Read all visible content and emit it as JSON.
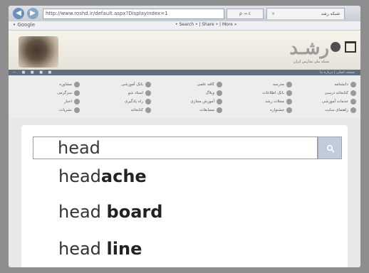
{
  "browser": {
    "back_icon": "back-arrow-icon",
    "forward_icon": "forward-arrow-icon",
    "address": "http://www.roshd.ir/default.aspx?DisplayIndex=1",
    "address_tools": "ρ → c",
    "tab_title": "شبکه رشد",
    "tab_close": "×"
  },
  "toolbar": {
    "google_label": "• Google",
    "links": "• Search • | Share • | More »"
  },
  "header": {
    "logo_text": "رشـد",
    "logo_sub": "شبکه ملی مدارس ایران"
  },
  "strip": {
    "dots": "— ■ ■ ■ ■",
    "right": "صفحه اصلی | درباره ما"
  },
  "links": {
    "col1": [
      "دانشنامه",
      "کتابخانه درسی",
      "خدمات آموزشی",
      "راهنمای سایت"
    ],
    "col2": [
      "مدرسه",
      "بانک اطلاعات",
      "مجلات رشد",
      "جشنواره"
    ],
    "col3": [
      "کافه علمی",
      "وبلاگ",
      "آموزش مجازی",
      "مسابقات"
    ],
    "col4": [
      "بانک آموزشی",
      "استاد شو",
      "راه یادگیری",
      "کتابخانه"
    ],
    "col5": [
      "مشاوره",
      "سرگرمی",
      "اخبار",
      "نشریات"
    ]
  },
  "search": {
    "value": "head",
    "button_icon": "search-icon"
  },
  "suggestions": [
    {
      "prefix": "head",
      "completion": "ache"
    },
    {
      "prefix": "head ",
      "completion": "board"
    },
    {
      "prefix": "head ",
      "completion": "line"
    }
  ]
}
